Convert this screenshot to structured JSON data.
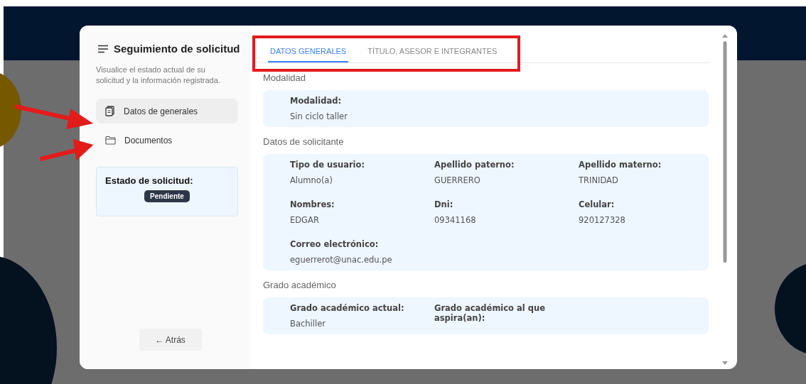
{
  "sidebar": {
    "title": "Seguimiento de solicitud",
    "description": "Visualice el estado actual de su solicitud y la información registrada.",
    "nav": [
      {
        "label": "Datos de generales",
        "selected": true
      },
      {
        "label": "Documentos",
        "selected": false
      }
    ],
    "status": {
      "label": "Estado de solicitud:",
      "badge": "Pendiente"
    },
    "back_button": "← Atrás"
  },
  "tabs": [
    {
      "label": "DATOS GENERALES",
      "selected": true
    },
    {
      "label": "TÍTULO, ASESOR E INTEGRANTES",
      "selected": false
    }
  ],
  "sections": [
    {
      "title": "Modalidad",
      "fields": [
        {
          "label": "Modalidad:",
          "value": "Sin ciclo taller"
        }
      ]
    },
    {
      "title": "Datos de solicitante",
      "fields": [
        {
          "label": "Tipo de usuario:",
          "value": "Alumno(a)"
        },
        {
          "label": "Apellido paterno:",
          "value": "GUERRERO"
        },
        {
          "label": "Apellido materno:",
          "value": "TRINIDAD"
        },
        {
          "label": "Nombres:",
          "value": "EDGAR"
        },
        {
          "label": "Dni:",
          "value": "09341168"
        },
        {
          "label": "Celular:",
          "value": "920127328"
        },
        {
          "label": "Correo electrónico:",
          "value": "eguerrerot@unac.edu.pe"
        }
      ]
    },
    {
      "title": "Grado académico",
      "fields": [
        {
          "label": "Grado académico actual:",
          "value": "Bachiller"
        },
        {
          "label": "Grado académico al que aspira(an):"
        }
      ]
    }
  ]
}
